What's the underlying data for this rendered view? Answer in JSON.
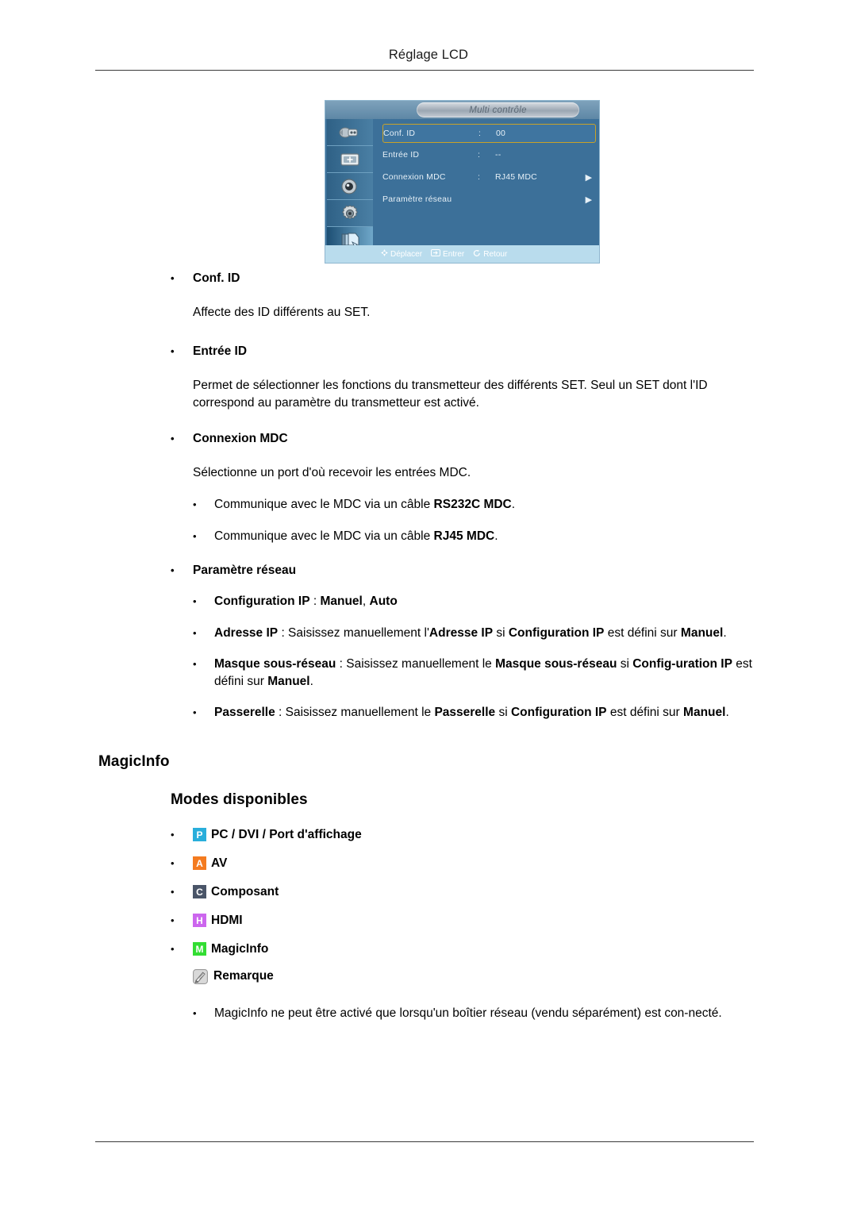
{
  "page": {
    "header_title": "Réglage LCD"
  },
  "osd": {
    "title": "Multi contrôle",
    "sidebar_icons": [
      {
        "name": "input-source-icon",
        "selected": false
      },
      {
        "name": "picture-icon",
        "selected": false
      },
      {
        "name": "sound-speaker-icon",
        "selected": false
      },
      {
        "name": "setup-gear-icon",
        "selected": false
      },
      {
        "name": "multi-control-icon",
        "selected": true
      }
    ],
    "rows": [
      {
        "label": "Conf. ID",
        "colon": ":",
        "value": "00",
        "arrow": "",
        "highlighted": true
      },
      {
        "label": "Entrée ID",
        "colon": ":",
        "value": "--",
        "arrow": "",
        "highlighted": false
      },
      {
        "label": "Connexion MDC",
        "colon": ":",
        "value": "RJ45 MDC",
        "arrow": "▶",
        "highlighted": false
      },
      {
        "label": "Paramètre réseau",
        "colon": "",
        "value": "",
        "arrow": "▶",
        "highlighted": false
      }
    ],
    "footer_hints": [
      {
        "icon": "move-icon",
        "label": "Déplacer"
      },
      {
        "icon": "enter-icon",
        "label": "Entrer"
      },
      {
        "icon": "return-icon",
        "label": "Retour"
      }
    ],
    "highlight_color": "#c9a227",
    "background_color": "#3c7099"
  },
  "sections": {
    "conf_id": {
      "title": "Conf. ID",
      "body": "Affecte des ID différents au SET."
    },
    "entree_id": {
      "title": "Entrée ID",
      "body": "Permet de sélectionner les fonctions du transmetteur des différents SET. Seul un SET dont l'ID correspond au paramètre du transmetteur est activé."
    },
    "connexion_mdc": {
      "title": "Connexion MDC",
      "body": "Sélectionne un port d'où recevoir les entrées MDC.",
      "items": [
        {
          "prefix": "Communique avec le MDC via un câble ",
          "bold": "RS232C MDC",
          "suffix": "."
        },
        {
          "prefix": "Communique avec le MDC via un câble ",
          "bold": "RJ45 MDC",
          "suffix": "."
        }
      ]
    },
    "parametre_reseau": {
      "title": "Paramètre réseau",
      "items": [
        {
          "id": "configuration-ip",
          "html": "<b>Configuration IP</b> : <b>Manuel</b>, <b>Auto</b>"
        },
        {
          "id": "adresse-ip",
          "html": "<b>Adresse IP</b> : Saisissez manuellement l'<b>Adresse IP</b> si <b>Configuration IP</b> est défini sur <b>Manuel</b>."
        },
        {
          "id": "masque-sous-reseau",
          "html": "<b>Masque sous-réseau</b> : Saisissez manuellement le <b>Masque sous-réseau</b> si <b>Config-uration IP</b> est défini sur <b>Manuel</b>."
        },
        {
          "id": "passerelle",
          "html": "<b>Passerelle</b> : Saisissez manuellement le <b>Passerelle</b> si <b>Configuration IP</b> est défini sur <b>Manuel</b>."
        }
      ]
    }
  },
  "magicinfo": {
    "heading": "MagicInfo",
    "subheading": "Modes disponibles",
    "modes": [
      {
        "badge": "P",
        "color": "#29aedb",
        "label": "PC / DVI / Port d'affichage",
        "icon_name": "mode-badge-pc"
      },
      {
        "badge": "A",
        "color": "#f47b20",
        "label": "AV",
        "icon_name": "mode-badge-av"
      },
      {
        "badge": "C",
        "color": "#4a5568",
        "label": "Composant",
        "icon_name": "mode-badge-component"
      },
      {
        "badge": "H",
        "color": "#cc66ee",
        "label": "HDMI",
        "icon_name": "mode-badge-hdmi"
      },
      {
        "badge": "M",
        "color": "#33dd33",
        "label": "MagicInfo",
        "icon_name": "mode-badge-magicinfo"
      }
    ],
    "note": {
      "label": "Remarque",
      "icon_name": "note-pen-icon",
      "text": "MagicInfo ne peut être activé que lorsqu'un boîtier réseau (vendu séparément) est con-necté."
    }
  }
}
